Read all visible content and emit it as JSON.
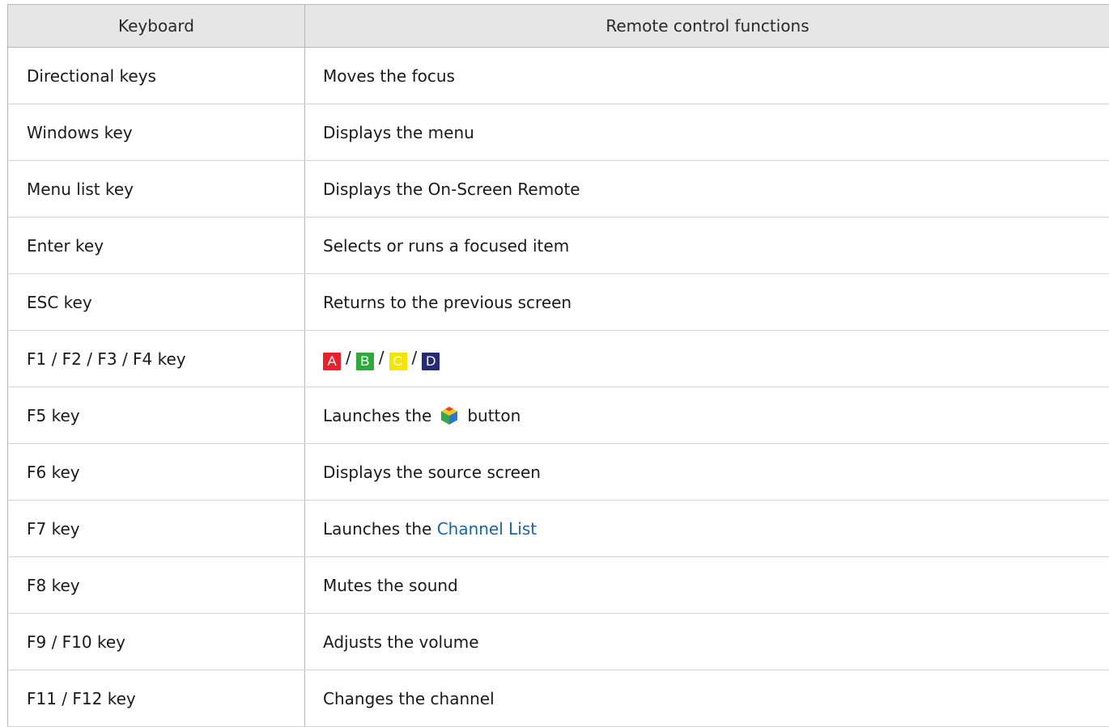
{
  "table": {
    "headers": [
      "Keyboard",
      "Remote control functions"
    ],
    "rows": [
      {
        "key": "Directional keys",
        "function": "Moves the focus"
      },
      {
        "key": "Windows key",
        "function": "Displays the menu"
      },
      {
        "key": "Menu list key",
        "function": "Displays the On-Screen Remote"
      },
      {
        "key": "Enter key",
        "function": "Selects or runs a focused item"
      },
      {
        "key": "ESC key",
        "function": "Returns to the previous screen"
      },
      {
        "key": "F1 / F2 / F3 / F4 key",
        "color_buttons": {
          "a": "A",
          "b": "B",
          "c": "C",
          "d": "D",
          "separator": "/"
        }
      },
      {
        "key": "F5 key",
        "function_before": "Launches the",
        "icon": "smart-hub-icon",
        "function_after": "button"
      },
      {
        "key": "F6 key",
        "function": "Displays the source screen"
      },
      {
        "key": "F7 key",
        "function_before": "Launches the",
        "function_link": "Channel List"
      },
      {
        "key": "F8 key",
        "function": "Mutes the sound"
      },
      {
        "key": "F9 / F10 key",
        "function": "Adjusts the volume"
      },
      {
        "key": "F11 / F12 key",
        "function": "Changes the channel"
      }
    ]
  },
  "colors": {
    "button_a": "#e8212e",
    "button_b": "#2eaa3a",
    "button_c": "#f5e400",
    "button_d": "#26287a",
    "link": "#1565a8",
    "header_bg": "#e6e6e6"
  }
}
